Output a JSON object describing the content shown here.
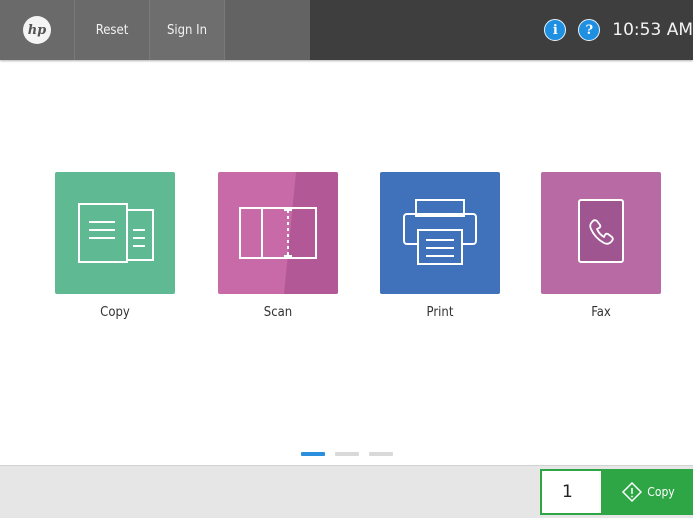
{
  "header": {
    "logo_text": "hp",
    "reset_label": "Reset",
    "signin_label": "Sign In",
    "info_icon": "info-icon",
    "help_icon": "help-icon",
    "time": "10:53 AM"
  },
  "apps": [
    {
      "label": "Copy",
      "color": "#5fb992",
      "icon": "copy-icon"
    },
    {
      "label": "Scan",
      "color": "#c86aa8",
      "icon": "scan-icon"
    },
    {
      "label": "Print",
      "color": "#3f72bb",
      "icon": "print-icon"
    },
    {
      "label": "Fax",
      "color": "#b86aa5",
      "icon": "fax-icon"
    }
  ],
  "pager": {
    "pages": 3,
    "current": 1
  },
  "footer": {
    "copies": "1",
    "copy_label": "Copy",
    "accent": "#2ea646"
  }
}
